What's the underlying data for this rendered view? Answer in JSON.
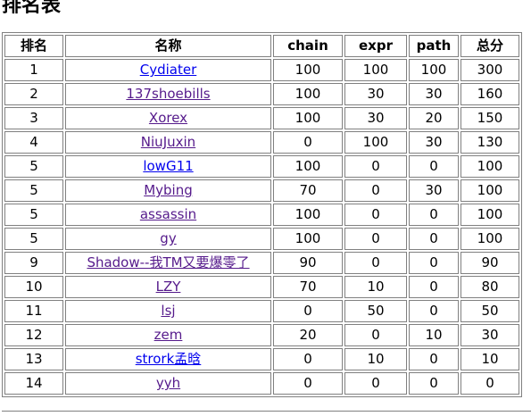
{
  "page": {
    "title": "排名表"
  },
  "table": {
    "headers": {
      "rank": "排名",
      "name": "名称",
      "chain": "chain",
      "expr": "expr",
      "path": "path",
      "total": "总分"
    },
    "rows": [
      {
        "rank": "1",
        "name": "Cydiater",
        "chain": "100",
        "expr": "100",
        "path": "100",
        "total": "300",
        "visited": false
      },
      {
        "rank": "2",
        "name": "137shoebills",
        "chain": "100",
        "expr": "30",
        "path": "30",
        "total": "160",
        "visited": true
      },
      {
        "rank": "3",
        "name": "Xorex",
        "chain": "100",
        "expr": "30",
        "path": "20",
        "total": "150",
        "visited": true
      },
      {
        "rank": "4",
        "name": "NiuJuxin",
        "chain": "0",
        "expr": "100",
        "path": "30",
        "total": "130",
        "visited": true
      },
      {
        "rank": "5",
        "name": "lowG11",
        "chain": "100",
        "expr": "0",
        "path": "0",
        "total": "100",
        "visited": false
      },
      {
        "rank": "5",
        "name": "Mybing",
        "chain": "70",
        "expr": "0",
        "path": "30",
        "total": "100",
        "visited": true
      },
      {
        "rank": "5",
        "name": "assassin",
        "chain": "100",
        "expr": "0",
        "path": "0",
        "total": "100",
        "visited": true
      },
      {
        "rank": "5",
        "name": "gy",
        "chain": "100",
        "expr": "0",
        "path": "0",
        "total": "100",
        "visited": true
      },
      {
        "rank": "9",
        "name": "Shadow--我TM又要爆零了",
        "chain": "90",
        "expr": "0",
        "path": "0",
        "total": "90",
        "visited": true
      },
      {
        "rank": "10",
        "name": "LZY",
        "chain": "70",
        "expr": "10",
        "path": "0",
        "total": "80",
        "visited": true
      },
      {
        "rank": "11",
        "name": "lsj",
        "chain": "0",
        "expr": "50",
        "path": "0",
        "total": "50",
        "visited": true
      },
      {
        "rank": "12",
        "name": "zem",
        "chain": "20",
        "expr": "0",
        "path": "10",
        "total": "30",
        "visited": true
      },
      {
        "rank": "13",
        "name": "strork孟晗",
        "chain": "0",
        "expr": "10",
        "path": "0",
        "total": "10",
        "visited": false
      },
      {
        "rank": "14",
        "name": "yyh",
        "chain": "0",
        "expr": "0",
        "path": "0",
        "total": "0",
        "visited": true
      }
    ]
  },
  "colors": {
    "link": "#0000ee",
    "visited_link": "#551a8b",
    "border": "#808080"
  }
}
